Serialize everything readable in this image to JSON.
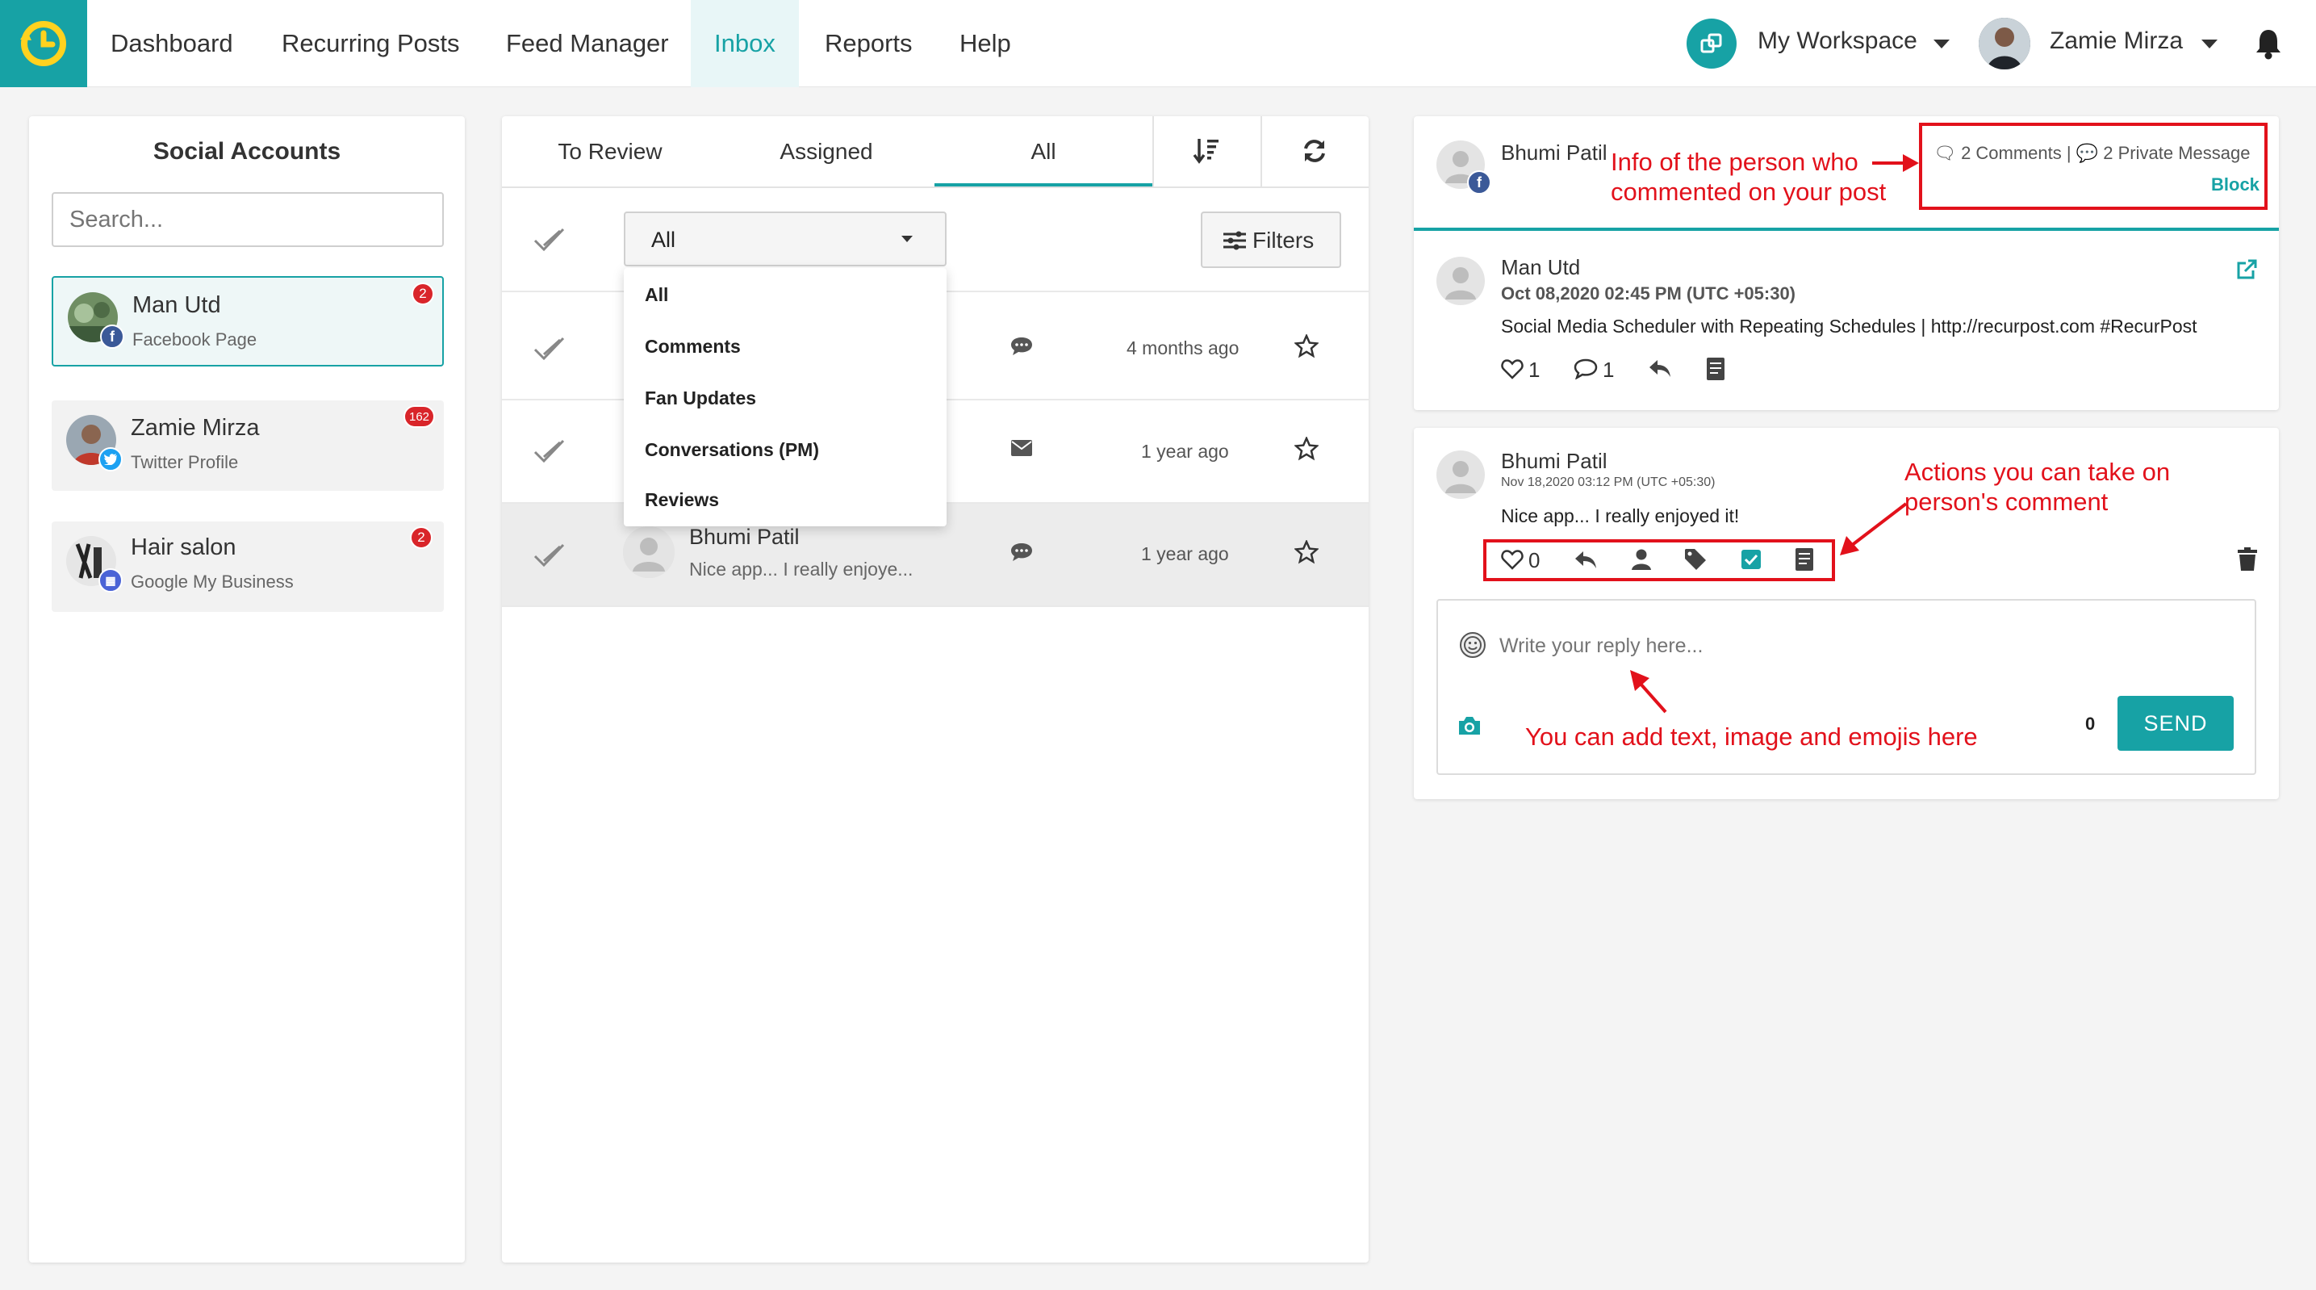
{
  "nav": {
    "items": [
      "Dashboard",
      "Recurring Posts",
      "Feed Manager",
      "Inbox",
      "Reports",
      "Help"
    ],
    "active": "Inbox",
    "workspace": "My Workspace",
    "user": "Zamie Mirza"
  },
  "accounts": {
    "title": "Social Accounts",
    "search_placeholder": "Search...",
    "items": [
      {
        "name": "Man Utd",
        "type": "Facebook Page",
        "count": "2"
      },
      {
        "name": "Zamie Mirza",
        "type": "Twitter Profile",
        "count": "162"
      },
      {
        "name": "Hair salon",
        "type": "Google My Business",
        "count": "2"
      }
    ]
  },
  "inbox": {
    "tabs": [
      "To Review",
      "Assigned",
      "All"
    ],
    "active_tab": "All",
    "filter_selected": "All",
    "filters_label": "Filters",
    "dropdown_options": [
      "All",
      "Comments",
      "Fan Updates",
      "Conversations (PM)",
      "Reviews"
    ],
    "rows": [
      {
        "time": "4 months ago",
        "icon": "comment-icon"
      },
      {
        "time": "1 year ago",
        "icon": "envelope-icon"
      },
      {
        "name": "Bhumi Patil",
        "preview": "Nice app... I really enjoye...",
        "time": "1 year ago",
        "icon": "comment-icon"
      }
    ]
  },
  "detail": {
    "header": {
      "name": "Bhumi Patil",
      "comments": "2 Comments",
      "separator": "|",
      "private_messages": "2 Private Message",
      "block": "Block"
    },
    "post": {
      "author": "Man Utd",
      "date": "Oct 08,2020 02:45 PM (UTC +05:30)",
      "text": "Social Media Scheduler with Repeating Schedules | http://recurpost.com #RecurPost",
      "likes": "1",
      "comments": "1"
    },
    "comment": {
      "author": "Bhumi Patil",
      "date": "Nov 18,2020 03:12 PM (UTC +05:30)",
      "text": "Nice app... I really enjoyed it!",
      "likes": "0"
    },
    "reply": {
      "placeholder": "Write your reply here...",
      "char_count": "0",
      "send_label": "SEND"
    }
  },
  "annotations": {
    "info": "Info of the person who commented on your post",
    "actions": "Actions you can take on person's comment",
    "reply": "You can add text, image and emojis here"
  },
  "colors": {
    "accent": "#17a2a5",
    "annotation": "#e2111b",
    "badge": "#d9252a",
    "facebook": "#3b5998",
    "twitter": "#1da1f2",
    "gmb": "#4a63d6"
  }
}
